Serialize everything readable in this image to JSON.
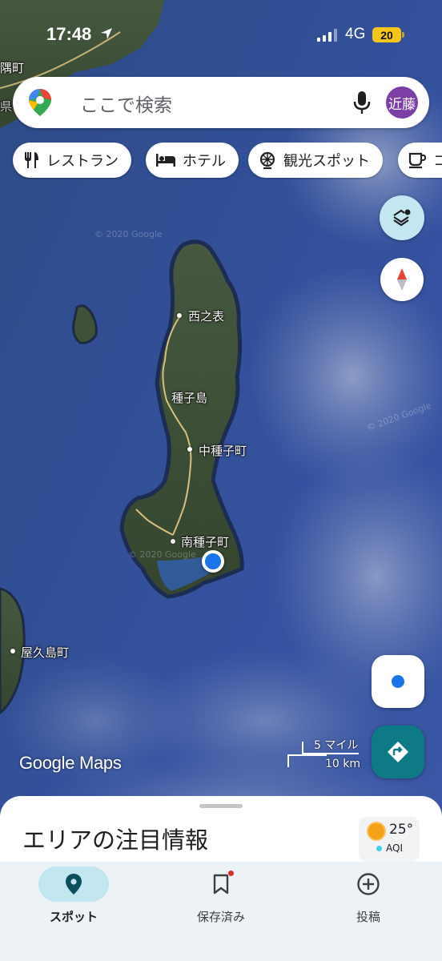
{
  "status_bar": {
    "time": "17:48",
    "network": "4G",
    "battery": "20"
  },
  "search": {
    "placeholder": "ここで検索",
    "avatar_initials": "近藤"
  },
  "chips": [
    {
      "label": "レストラン",
      "icon": "restaurant-icon"
    },
    {
      "label": "ホテル",
      "icon": "hotel-icon"
    },
    {
      "label": "観光スポット",
      "icon": "attraction-icon"
    },
    {
      "label": "コ",
      "icon": "coffee-icon"
    }
  ],
  "map": {
    "labels": {
      "nishinoomote": "西之表",
      "tanegashima": "種子島",
      "nakatane": "中種子町",
      "minamitane": "南種子町",
      "yakushima": "屋久島町",
      "corner_top_left": "隅町",
      "corner_left": "県"
    },
    "watermarks": [
      "© 2020 Google",
      "© 2020 Google",
      "© 2020 Google"
    ],
    "logo": "Google Maps",
    "scale": {
      "miles": "5 マイル",
      "km": "10 km"
    }
  },
  "sheet": {
    "title": "エリアの注目情報",
    "weather": {
      "temp": "25°",
      "aqi": "AQI"
    }
  },
  "nav": {
    "items": [
      {
        "label": "スポット",
        "icon": "place-icon",
        "active": true
      },
      {
        "label": "保存済み",
        "icon": "bookmark-icon",
        "active": false
      },
      {
        "label": "投稿",
        "icon": "add-circle-icon",
        "active": false
      }
    ]
  },
  "colors": {
    "ocean": "#2f4a8c",
    "land": "#3e4f3a",
    "accent_teal": "#0e7a86",
    "chip_active": "#c2e7f0",
    "location_blue": "#1a73e8",
    "avatar": "#7b3fa6"
  }
}
